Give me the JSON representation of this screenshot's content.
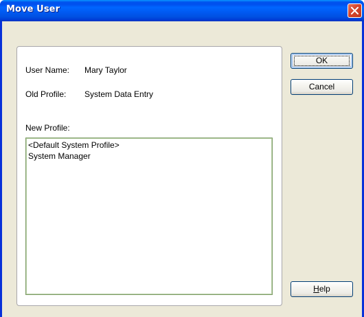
{
  "window": {
    "title": "Move User"
  },
  "form": {
    "user_name_label": "User Name:",
    "user_name_value": "Mary Taylor",
    "old_profile_label": "Old Profile:",
    "old_profile_value": "System Data Entry",
    "new_profile_label": "New Profile:"
  },
  "profiles": [
    "<Default System Profile>",
    "System Manager"
  ],
  "buttons": {
    "ok": "OK",
    "cancel": "Cancel",
    "help_mnemonic": "H",
    "help_rest": "elp"
  },
  "icons": {
    "close": "close-icon"
  },
  "colors": {
    "titlebar": "#0058f0",
    "dialog_face": "#ece9d8",
    "close_button": "#d6452c",
    "button_border": "#003c74"
  }
}
